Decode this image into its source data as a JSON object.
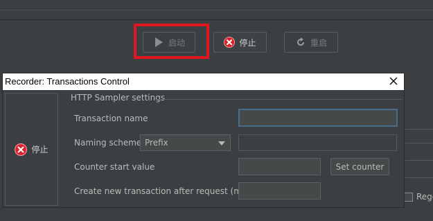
{
  "toolbar": {
    "start_label": "启动",
    "stop_label": "停止",
    "restart_label": "重启"
  },
  "background": {
    "regex_label": "Regex"
  },
  "dialog": {
    "title": "Recorder: Transactions Control",
    "stop_label": "停止",
    "group_title": "HTTP Sampler settings",
    "transaction_name_label": "Transaction name",
    "transaction_name_value": "",
    "naming_scheme_label": "Naming scheme",
    "naming_scheme_selected": "Prefix",
    "naming_scheme_value": "",
    "counter_start_label": "Counter start value",
    "counter_start_value": "",
    "set_counter_label": "Set counter",
    "create_new_label": "Create new transaction after request (ms):",
    "create_new_value": ""
  },
  "colors": {
    "highlight_box": "#e0161f",
    "stop_icon": "#d8232a",
    "focus_border": "#4a6d8c"
  }
}
